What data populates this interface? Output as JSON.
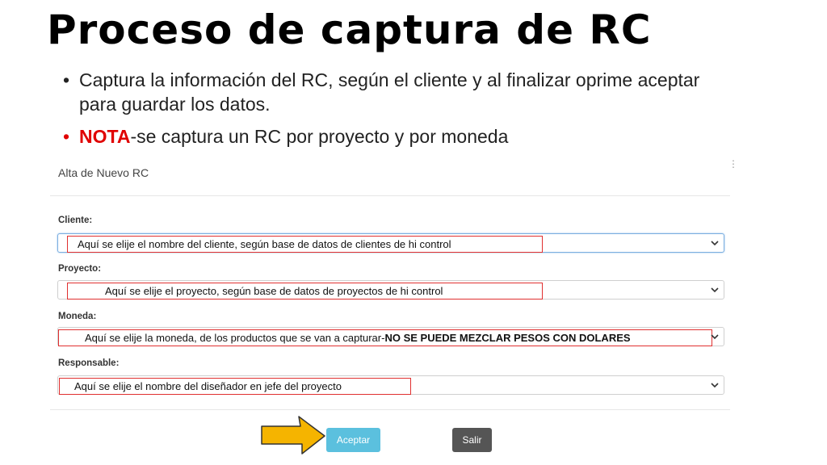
{
  "slide": {
    "title": "Proceso de captura de RC",
    "bullet1": "Captura la información del RC, según el cliente y al finalizar oprime aceptar para guardar los datos.",
    "note_label": "NOTA",
    "note_text": "-se captura un RC por proyecto y por moneda"
  },
  "form": {
    "header": "Alta de Nuevo RC",
    "fields": [
      {
        "label": "Cliente:",
        "value": "Aquí se elije el nombre del cliente, según base de datos de clientes de hi control"
      },
      {
        "label": "Proyecto:",
        "value": "Aquí se elije el proyecto, según base de datos de proyectos de hi control"
      },
      {
        "label": "Moneda:",
        "value": "Aquí se elije la moneda, de los productos que se van a capturar-",
        "value_bold": "NO SE PUEDE MEZCLAR PESOS CON DOLARES"
      },
      {
        "label": "Responsable:",
        "value": "Aquí se elije el nombre del diseñador en jefe del proyecto"
      }
    ],
    "accept_label": "Aceptar",
    "exit_label": "Salir"
  },
  "colors": {
    "note": "#e00000",
    "accept_button": "#5bc0de",
    "exit_button": "#555555",
    "annotation_box": "#e03030",
    "arrow_fill": "#f5b400"
  },
  "icons": {
    "select_arrow": "chevron-down-icon",
    "pointer": "arrow-right-icon"
  }
}
